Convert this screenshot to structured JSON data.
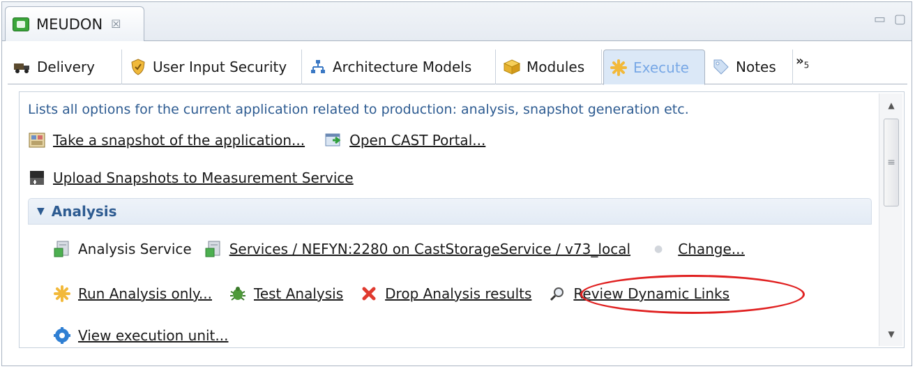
{
  "editor": {
    "title": "MEUDON",
    "close_glyph": "☒",
    "window_controls": [
      "▭",
      "▢"
    ]
  },
  "subtabs": [
    {
      "label": "Delivery",
      "icon": "truck-icon"
    },
    {
      "label": "User Input Security",
      "icon": "shield-icon"
    },
    {
      "label": "Architecture Models",
      "icon": "hierarchy-icon"
    },
    {
      "label": "Modules",
      "icon": "cube-icon"
    },
    {
      "label": "Execute",
      "icon": "execute-star-icon",
      "active": true
    },
    {
      "label": "Notes",
      "icon": "tag-icon"
    }
  ],
  "overflow": {
    "glyph": "»",
    "count": "5"
  },
  "content": {
    "description": "Lists all options for the current application related to production: analysis, snapshot generation etc.",
    "snapshot_link": "Take a snapshot of the application...",
    "portal_link": "Open CAST Portal...",
    "upload_link": "Upload Snapshots to Measurement Service",
    "section_title": "Analysis",
    "analysis_service_label": "Analysis Service",
    "service_link": "Services / NEFYN:2280 on CastStorageService / v73_local",
    "change_link": "Change...",
    "run_link": "Run Analysis only...",
    "test_link": "Test Analysis",
    "drop_link": "Drop Analysis results",
    "review_link": "Review Dynamic Links",
    "view_link": "View execution unit..."
  },
  "colors": {
    "accent_text": "#2d5b91",
    "active_tab_text": "#78a8e6",
    "highlight_ring": "#e02020"
  }
}
